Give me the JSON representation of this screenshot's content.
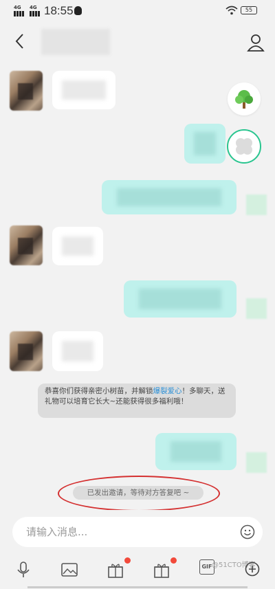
{
  "status_bar": {
    "signal_1": "4G",
    "signal_2": "4G",
    "time": "18:55",
    "battery": "55"
  },
  "header": {
    "title": ""
  },
  "system_message": {
    "text_before": "恭喜你们获得亲密小树苗，并解锁",
    "link": "爆裂爱心",
    "text_after": "！多聊天，送礼物可以培育它长大~还能获得很多福利哦！"
  },
  "invite_notice": "已发出邀请，等待对方答复吧 ~",
  "composer": {
    "placeholder": "请输入消息..."
  },
  "toolbar": {
    "gif_label": "GIF",
    "watermark": "@51CTO博客"
  },
  "colors": {
    "accent_link": "#2a8fd6",
    "annotation_red": "#d43030",
    "outgoing_bubble": "#bff1ec",
    "notification_dot": "#f24a3b"
  }
}
